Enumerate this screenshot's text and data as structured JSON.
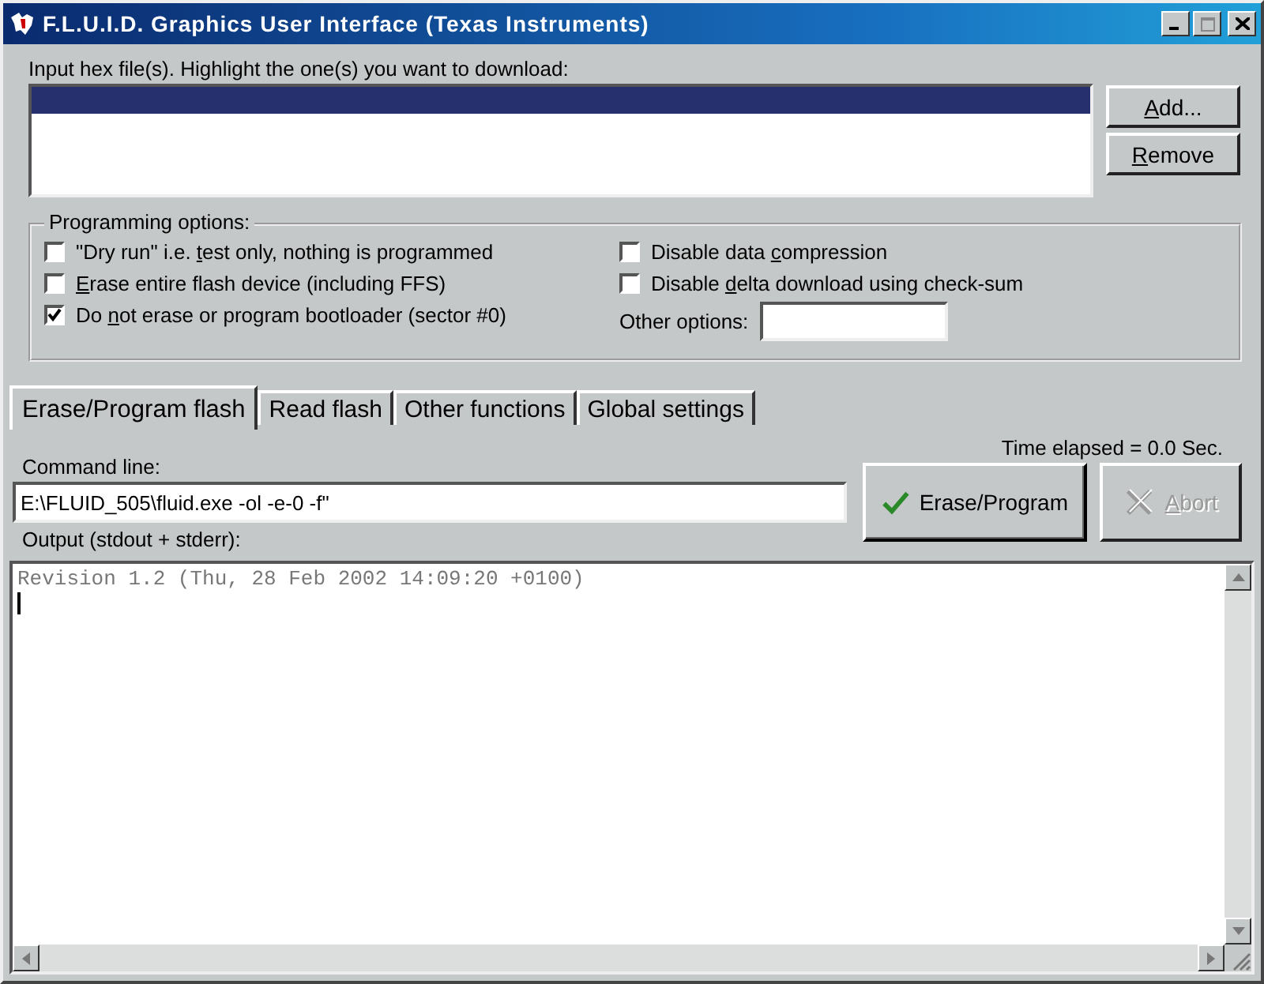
{
  "window": {
    "title": "F.L.U.I.D. Graphics User Interface (Texas Instruments)"
  },
  "hex_files": {
    "label": "Input hex file(s). Highlight the one(s) you want to download:",
    "rows": [
      {
        "selected": true
      }
    ],
    "buttons": [
      {
        "label": {
          "underlined": "A",
          "after": "dd..."
        },
        "disabled": false
      },
      {
        "label": {
          "underlined": "R",
          "after": "emove"
        },
        "disabled": false
      }
    ]
  },
  "programming_options": {
    "title": "Programming options:",
    "checkboxes": [
      {
        "label": {
          "before": "\"Dry run\" i.e. ",
          "underlined": "t",
          "after": "est only, nothing is programmed"
        },
        "checked": false
      },
      {
        "label": {
          "underlined": "E",
          "after": "rase entire flash device (including FFS)"
        },
        "checked": false
      },
      {
        "label": {
          "before": "Do ",
          "underlined": "n",
          "after": "ot erase or program bootloader (sector #0)"
        },
        "checked": true
      },
      {
        "label": {
          "before": "Disable data ",
          "underlined": "c",
          "after": "ompression"
        },
        "checked": false
      },
      {
        "label": {
          "before": "Disable ",
          "underlined": "d",
          "after": "elta download using check-sum"
        },
        "checked": false
      }
    ],
    "other_options": {
      "label": "Other options:"
    }
  },
  "tabs": [
    {
      "label": "Erase/Program flash",
      "selected": true
    },
    {
      "label": "Read flash",
      "selected": false
    },
    {
      "label": "Other functions",
      "selected": false
    },
    {
      "label": "Global settings",
      "selected": false
    }
  ],
  "erase_program": {
    "time_elapsed": "Time elapsed = 0.0 Sec.",
    "command_label": "Command line:",
    "command": "E:\\FLUID_505\\fluid.exe -ol -e-0 -f\"",
    "buttons": [
      {
        "kind": "check",
        "label": {
          "before": "Erase/Program"
        },
        "disabled": false
      },
      {
        "kind": "cross",
        "label": {
          "underlined": "A",
          "after": "bort"
        },
        "disabled": true
      }
    ],
    "output_label": "Output (stdout + stderr):",
    "output": "Revision 1.2 (Thu, 28 Feb 2002 14:09:20 +0100)"
  }
}
